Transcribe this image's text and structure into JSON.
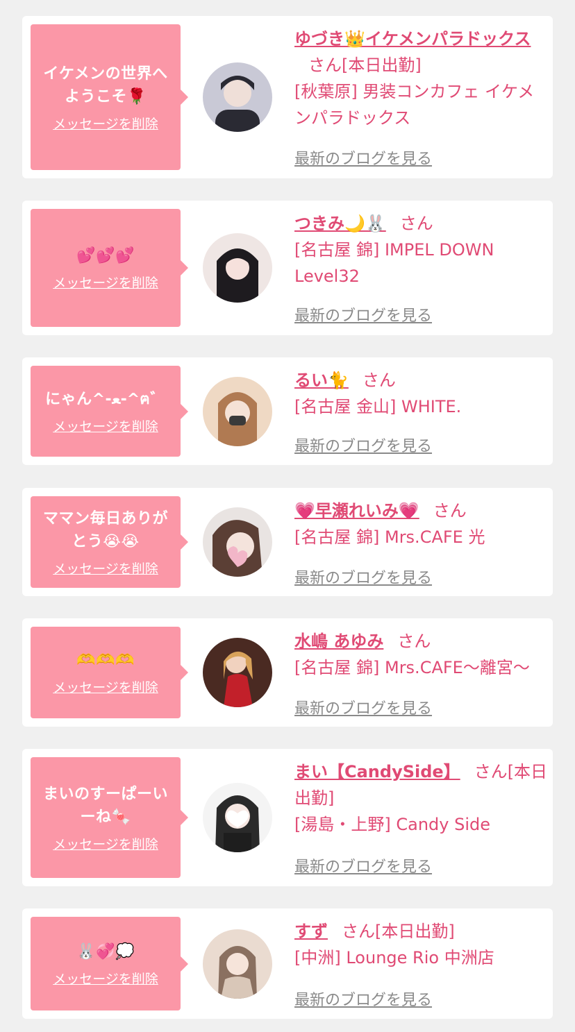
{
  "delete_label": "メッセージを削除",
  "blog_label": "最新のブログを見る",
  "honorific": "さん",
  "cards": [
    {
      "message_lines": [
        "イケメンの世界へ",
        "ようこそ🌹"
      ],
      "name": "ゆづき👑イケメンパラドックス",
      "status": "[本日出勤]",
      "area_shop": "[秋葉原] 男装コンカフェ イケメンパラドックス",
      "avatar_colors": [
        "#2a2a33",
        "#c9c9d6"
      ]
    },
    {
      "message_lines": [
        "💕💕💕"
      ],
      "name": "つきみ🌙🐰",
      "status": "",
      "area_shop": "[名古屋 錦] IMPEL DOWN Level32",
      "avatar_colors": [
        "#1e1b1f",
        "#efe6e4"
      ]
    },
    {
      "message_lines": [
        "にゃん^-ﻌ-^ฅ゛"
      ],
      "name": "るい🐈",
      "status": "",
      "area_shop": "[名古屋 金山] WHITE.",
      "avatar_colors": [
        "#b07a52",
        "#efd9c4"
      ]
    },
    {
      "message_lines": [
        "ママン毎日ありが",
        "とう😭😭"
      ],
      "name": "💗早瀬れいみ💗",
      "status": "",
      "area_shop": "[名古屋 錦] Mrs.CAFE 光",
      "avatar_colors": [
        "#5b3f35",
        "#f2b6c8"
      ]
    },
    {
      "message_lines": [
        "🫶🫶🫶"
      ],
      "name": "水嶋 あゆみ",
      "status": "",
      "area_shop": "[名古屋 錦] Mrs.CAFE〜離宮〜",
      "avatar_colors": [
        "#4a2a22",
        "#c2202a"
      ]
    },
    {
      "message_lines": [
        "まいのすーぱーい",
        "ーね🍬"
      ],
      "name": "まい【CandySide】",
      "status": "[本日出勤]",
      "area_shop": "[湯島・上野] Candy Side",
      "avatar_colors": [
        "#2a2a2a",
        "#f4f4f4"
      ]
    },
    {
      "message_lines": [
        "🐰💞💭"
      ],
      "name": "すず",
      "status": "[本日出勤]",
      "area_shop": "[中洲] Lounge Rio 中洲店",
      "avatar_colors": [
        "#8a7060",
        "#eadbd0"
      ]
    }
  ]
}
